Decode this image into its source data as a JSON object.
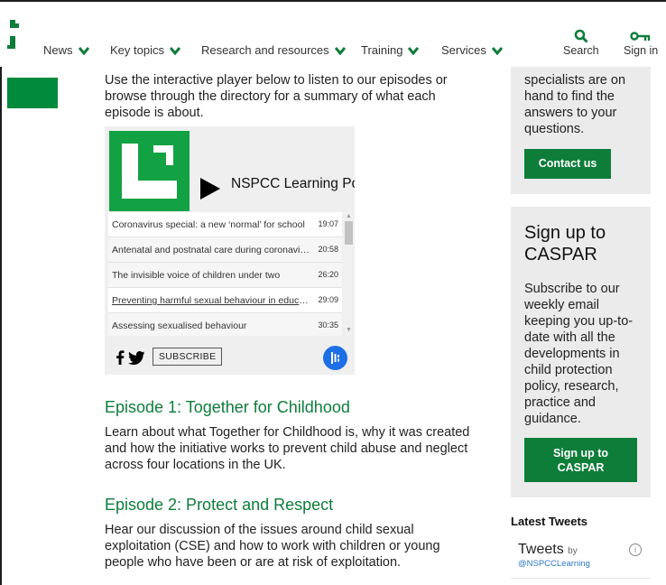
{
  "nav": {
    "items": [
      {
        "label": "News"
      },
      {
        "label": "Key topics"
      },
      {
        "label": "Research and resources"
      },
      {
        "label": "Training"
      },
      {
        "label": "Services"
      }
    ],
    "search_label": "Search",
    "signin_label": "Sign in"
  },
  "colors": {
    "brand_green": "#0e7d3a",
    "player_green": "#12a243",
    "podcast_blue": "#1e6fe6"
  },
  "intro": "Use the interactive player below to listen to our episodes or browse through the directory for a summary of what each episode is about.",
  "player": {
    "title": "NSPCC Learning Podcast",
    "episodes": [
      {
        "title": "Coronavirus special: a new ‘normal’ for school",
        "duration": "19:07"
      },
      {
        "title": "Antenatal and postnatal care during coronavirus",
        "duration": "20:58"
      },
      {
        "title": "The invisible voice of children under two",
        "duration": "26:20"
      },
      {
        "title": "Preventing harmful sexual behaviour in education",
        "duration": "29:09"
      },
      {
        "title": "Assessing sexualised behaviour",
        "duration": "30:35"
      }
    ],
    "subscribe_label": "SUBSCRIBE"
  },
  "episodes": [
    {
      "heading": "Episode 1: Together for Childhood",
      "body": "Learn about what Together for Childhood is, why it was created and how the initiative works to prevent child abuse and neglect across four locations in the UK."
    },
    {
      "heading": "Episode 2: Protect and Respect",
      "body": "Hear our discussion of the issues around child sexual exploitation (CSE) and how to work with children or young people who have been or are at risk of exploitation."
    }
  ],
  "sidebar": {
    "contact_text": "specialists are on hand to find the answers to your questions.",
    "contact_button": "Contact us",
    "caspar_heading": "Sign up to CASPAR",
    "caspar_text": "Subscribe to our weekly email keeping you up-to-date with all the developments in child protection policy, research, practice and guidance.",
    "caspar_button": "Sign up to CASPAR",
    "tweets_title": "Latest Tweets",
    "tweets_label": "Tweets",
    "tweets_by": "by",
    "tweets_handle": "@NSPCCLearning",
    "info_glyph": "i"
  }
}
